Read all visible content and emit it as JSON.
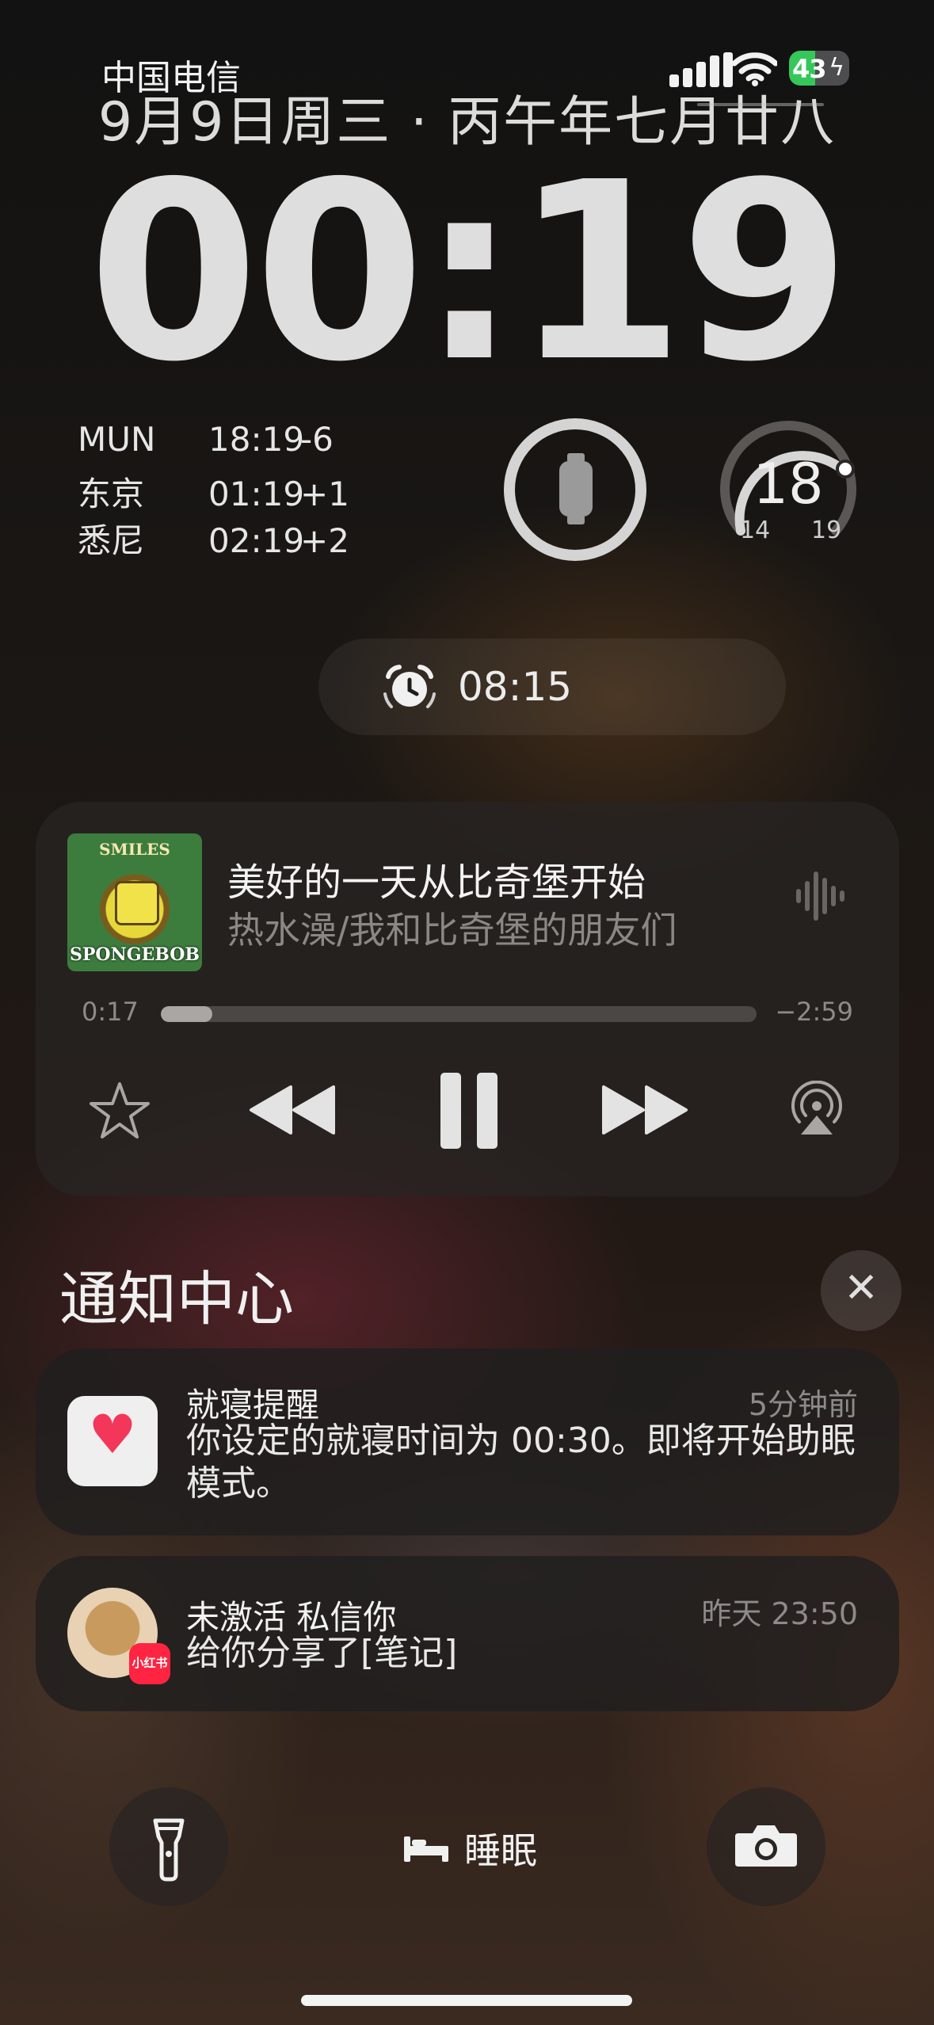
{
  "status_bar": {
    "carrier": "中国电信",
    "battery": "43",
    "battery_percent": 43
  },
  "lock": {
    "date": "9月9日周三 · 丙午年七月廿八",
    "time": "00:19"
  },
  "widgets": {
    "world_clock": [
      {
        "city": "MUN",
        "time": "18:19",
        "offset": "-6"
      },
      {
        "city": "东京",
        "time": "01:19",
        "offset": "+1"
      },
      {
        "city": "悉尼",
        "time": "02:19",
        "offset": "+2"
      }
    ],
    "watch": {
      "icon": "apple-watch-icon"
    },
    "weather": {
      "current": "18",
      "low": "14",
      "high": "19"
    }
  },
  "alarm": {
    "time": "08:15",
    "icon": "alarm-clock-icon"
  },
  "now_playing": {
    "art_text_top": "SMILES",
    "art_text_bottom": "SPONGEBOB",
    "title": "美好的一天从比奇堡开始",
    "artist": "热水澡/我和比奇堡的朋友们",
    "elapsed": "0:17",
    "remaining": "−2:59",
    "progress": 0.086,
    "icons": [
      "star-icon",
      "rewind-icon",
      "pause-icon",
      "fast-forward-icon",
      "airplay-icon",
      "waveform-icon"
    ]
  },
  "notification_center": {
    "title": "通知中心",
    "close_icon": "close-icon",
    "items": [
      {
        "app_icon": "health-heart-icon",
        "title": "就寝提醒",
        "time": "5分钟前",
        "body": "你设定的就寝时间为 00:30。即将开始助眠模式。"
      },
      {
        "app_icon": "avatar",
        "badge": "小红书",
        "title": "未激活 私信你",
        "time": "昨天 23:50",
        "body": "给你分享了[笔记]"
      }
    ]
  },
  "bottom_bar": {
    "sleep_label": "睡眠",
    "left_icon": "flashlight-icon",
    "right_icon": "camera-icon",
    "bed_icon": "bed-icon"
  },
  "colors": {
    "battery": "#35c759",
    "heart": "#f2375b",
    "xhs_badge": "#ff2442"
  }
}
